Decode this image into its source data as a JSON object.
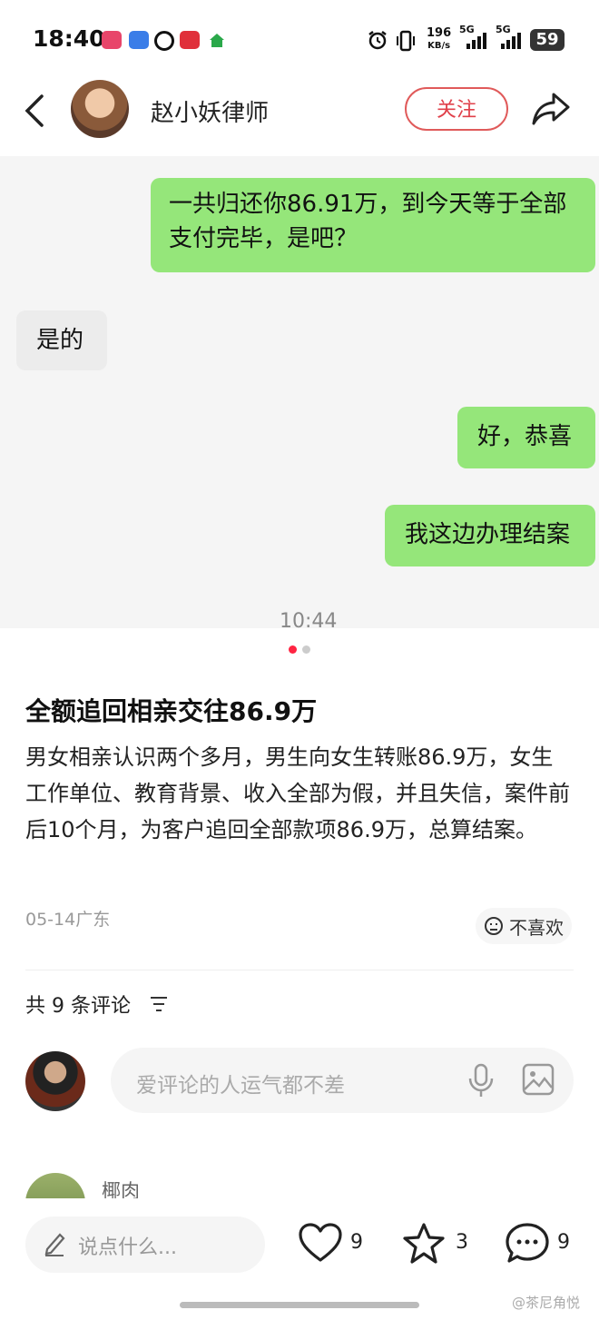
{
  "status_bar": {
    "time": "18:40",
    "app_icons": [
      {
        "name": "lala-icon",
        "color": "#e8456a"
      },
      {
        "name": "chat-icon",
        "color": "#3a7de8"
      },
      {
        "name": "netease-icon",
        "color": "#111111"
      },
      {
        "name": "shop-icon",
        "color": "#e0303a"
      },
      {
        "name": "home-icon",
        "color": "#2aa84a"
      }
    ],
    "speed_value": "196",
    "speed_unit": "KB/s",
    "net1": "5G",
    "net2": "5G",
    "battery": "59"
  },
  "header": {
    "author_name": "赵小妖律师",
    "follow_label": "关注"
  },
  "chat": {
    "messages": [
      {
        "side": "me",
        "text": "一共归还你86.91万，到今天等于全部支付完毕，是吧？"
      },
      {
        "side": "other",
        "text": "是的"
      },
      {
        "side": "me",
        "text": "好，恭喜"
      },
      {
        "side": "me",
        "text": "我这边办理结案"
      }
    ],
    "time": "10:44"
  },
  "carousel": {
    "total": 2,
    "active": 1,
    "active_color": "#ff2442",
    "inactive_color": "#cccccc"
  },
  "note": {
    "title": "全额追回相亲交往86.9万",
    "body": "男女相亲认识两个多月，男生向女生转账86.9万，女生工作单位、教育背景、收入全部为假，并且失信，案件前后10个月，为客户追回全部款项86.9万，总算结案。",
    "date_location": "05-14广东",
    "dislike_label": "不喜欢"
  },
  "comments": {
    "count_label": "共 9 条评论",
    "input_placeholder": "爱评论的人运气都不差",
    "first_commenter": "椰肉"
  },
  "bottom_bar": {
    "input_placeholder": "说点什么...",
    "likes": "9",
    "stars": "3",
    "comments": "9"
  },
  "watermark": "@茶尼角悦"
}
